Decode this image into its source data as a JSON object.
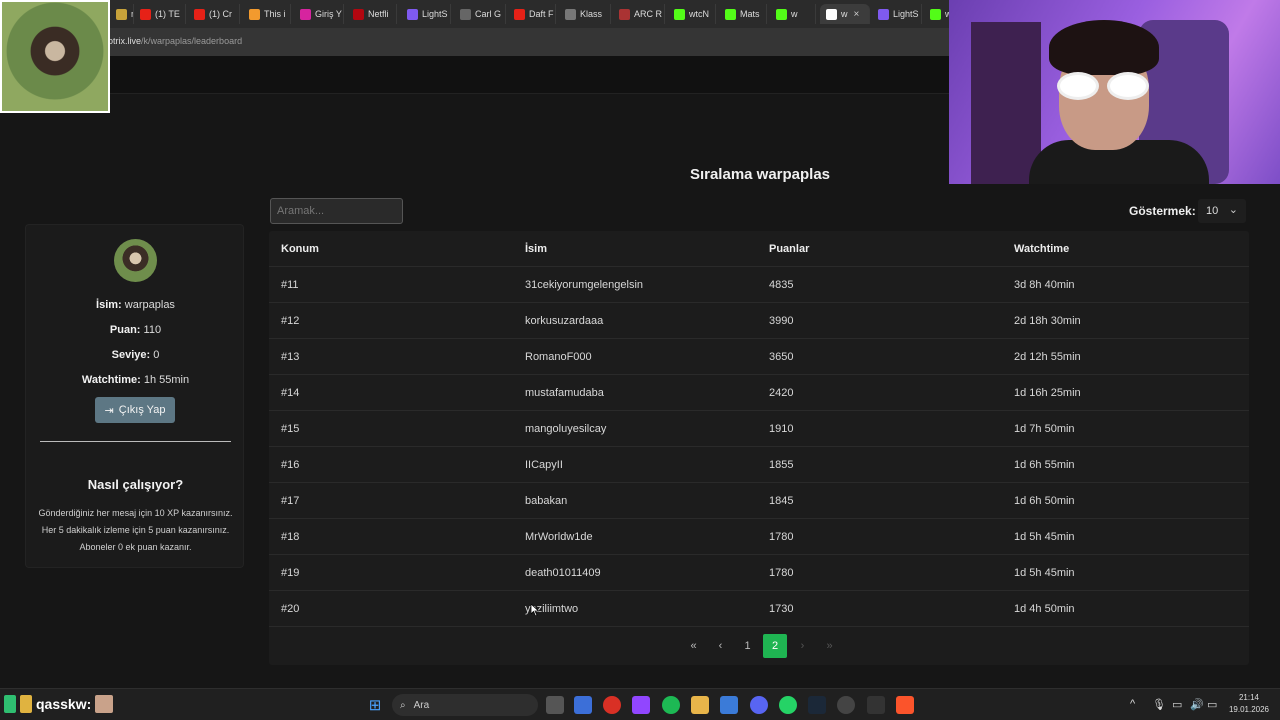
{
  "browser": {
    "tabs": [
      {
        "label": "ro",
        "icon": "tab-icon",
        "color": "#c7a23a"
      },
      {
        "label": "(1) TE",
        "icon": "youtube-icon",
        "color": "#e62117"
      },
      {
        "label": "(1) Cr",
        "icon": "youtube-icon",
        "color": "#e62117"
      },
      {
        "label": "This i",
        "icon": "tab-icon",
        "color": "#f29a2e"
      },
      {
        "label": "Giriş Y",
        "icon": "instagram-icon",
        "color": "#d6249f"
      },
      {
        "label": "Netfli",
        "icon": "netflix-icon",
        "color": "#b20710"
      },
      {
        "label": "LightS",
        "icon": "lightshot-icon",
        "color": "#7f5af0"
      },
      {
        "label": "Carl G",
        "icon": "globe-icon",
        "color": "#666666"
      },
      {
        "label": "Daft F",
        "icon": "youtube-icon",
        "color": "#e62117"
      },
      {
        "label": "Klass",
        "icon": "tab-icon",
        "color": "#777777"
      },
      {
        "label": "ARC R",
        "icon": "tab-icon",
        "color": "#a33"
      },
      {
        "label": "wtcN",
        "icon": "kick-icon",
        "color": "#53fc18"
      },
      {
        "label": "Mats",
        "icon": "kick-icon",
        "color": "#53fc18"
      },
      {
        "label": "w",
        "icon": "kick-icon",
        "color": "#53fc18"
      },
      {
        "label": "w",
        "icon": "botrix-icon",
        "color": "#ffffff",
        "active": true
      },
      {
        "label": "LightS",
        "icon": "lightshot-icon",
        "color": "#7f5af0"
      },
      {
        "label": "w",
        "icon": "kick-icon",
        "color": "#53fc18"
      }
    ],
    "url_host": "otrix.live",
    "url_path": "/k/warpaplas/leaderboard"
  },
  "page": {
    "title": "Sıralama warpaplas",
    "search_placeholder": "Aramak...",
    "show_label": "Göstermek:",
    "show_value": "10"
  },
  "profile": {
    "name_label": "İsim:",
    "name": "warpaplas",
    "points_label": "Puan:",
    "points": "110",
    "level_label": "Seviye:",
    "level": "0",
    "watchtime_label": "Watchtime:",
    "watchtime": "1h 55min",
    "logout_label": "Çıkış Yap",
    "how_title": "Nasıl çalışıyor?",
    "how_lines": [
      "Gönderdiğiniz her mesaj için 10 XP kazanırsınız.",
      "Her 5 dakikalık izleme için 5 puan kazanırsınız.",
      "Aboneler 0 ek puan kazanır."
    ]
  },
  "table": {
    "headers": [
      "Konum",
      "İsim",
      "Puanlar",
      "Watchtime"
    ],
    "rows": [
      [
        "#11",
        "31cekiyorumgelengelsin",
        "4835",
        "3d 8h 40min"
      ],
      [
        "#12",
        "korkusuzardaaa",
        "3990",
        "2d 18h 30min"
      ],
      [
        "#13",
        "RomanoF000",
        "3650",
        "2d 12h 55min"
      ],
      [
        "#14",
        "mustafamudaba",
        "2420",
        "1d 16h 25min"
      ],
      [
        "#15",
        "mangoluyesilcay",
        "1910",
        "1d 7h 50min"
      ],
      [
        "#16",
        "IICapyII",
        "1855",
        "1d 6h 55min"
      ],
      [
        "#17",
        "babakan",
        "1845",
        "1d 6h 50min"
      ],
      [
        "#18",
        "MrWorldw1de",
        "1780",
        "1d 5h 45min"
      ],
      [
        "#19",
        "death01011409",
        "1780",
        "1d 5h 45min"
      ],
      [
        "#20",
        "yaziliimtwo",
        "1730",
        "1d 4h 50min"
      ]
    ]
  },
  "pagination": {
    "first": "«",
    "prev": "‹",
    "pages": [
      "1",
      "2"
    ],
    "current": "2",
    "next": "›",
    "last": "»"
  },
  "taskbar": {
    "user": "qasskw:",
    "search_label": "Ara",
    "time": "21:14",
    "date": "19.01.2026",
    "accent": "#1fb552"
  }
}
